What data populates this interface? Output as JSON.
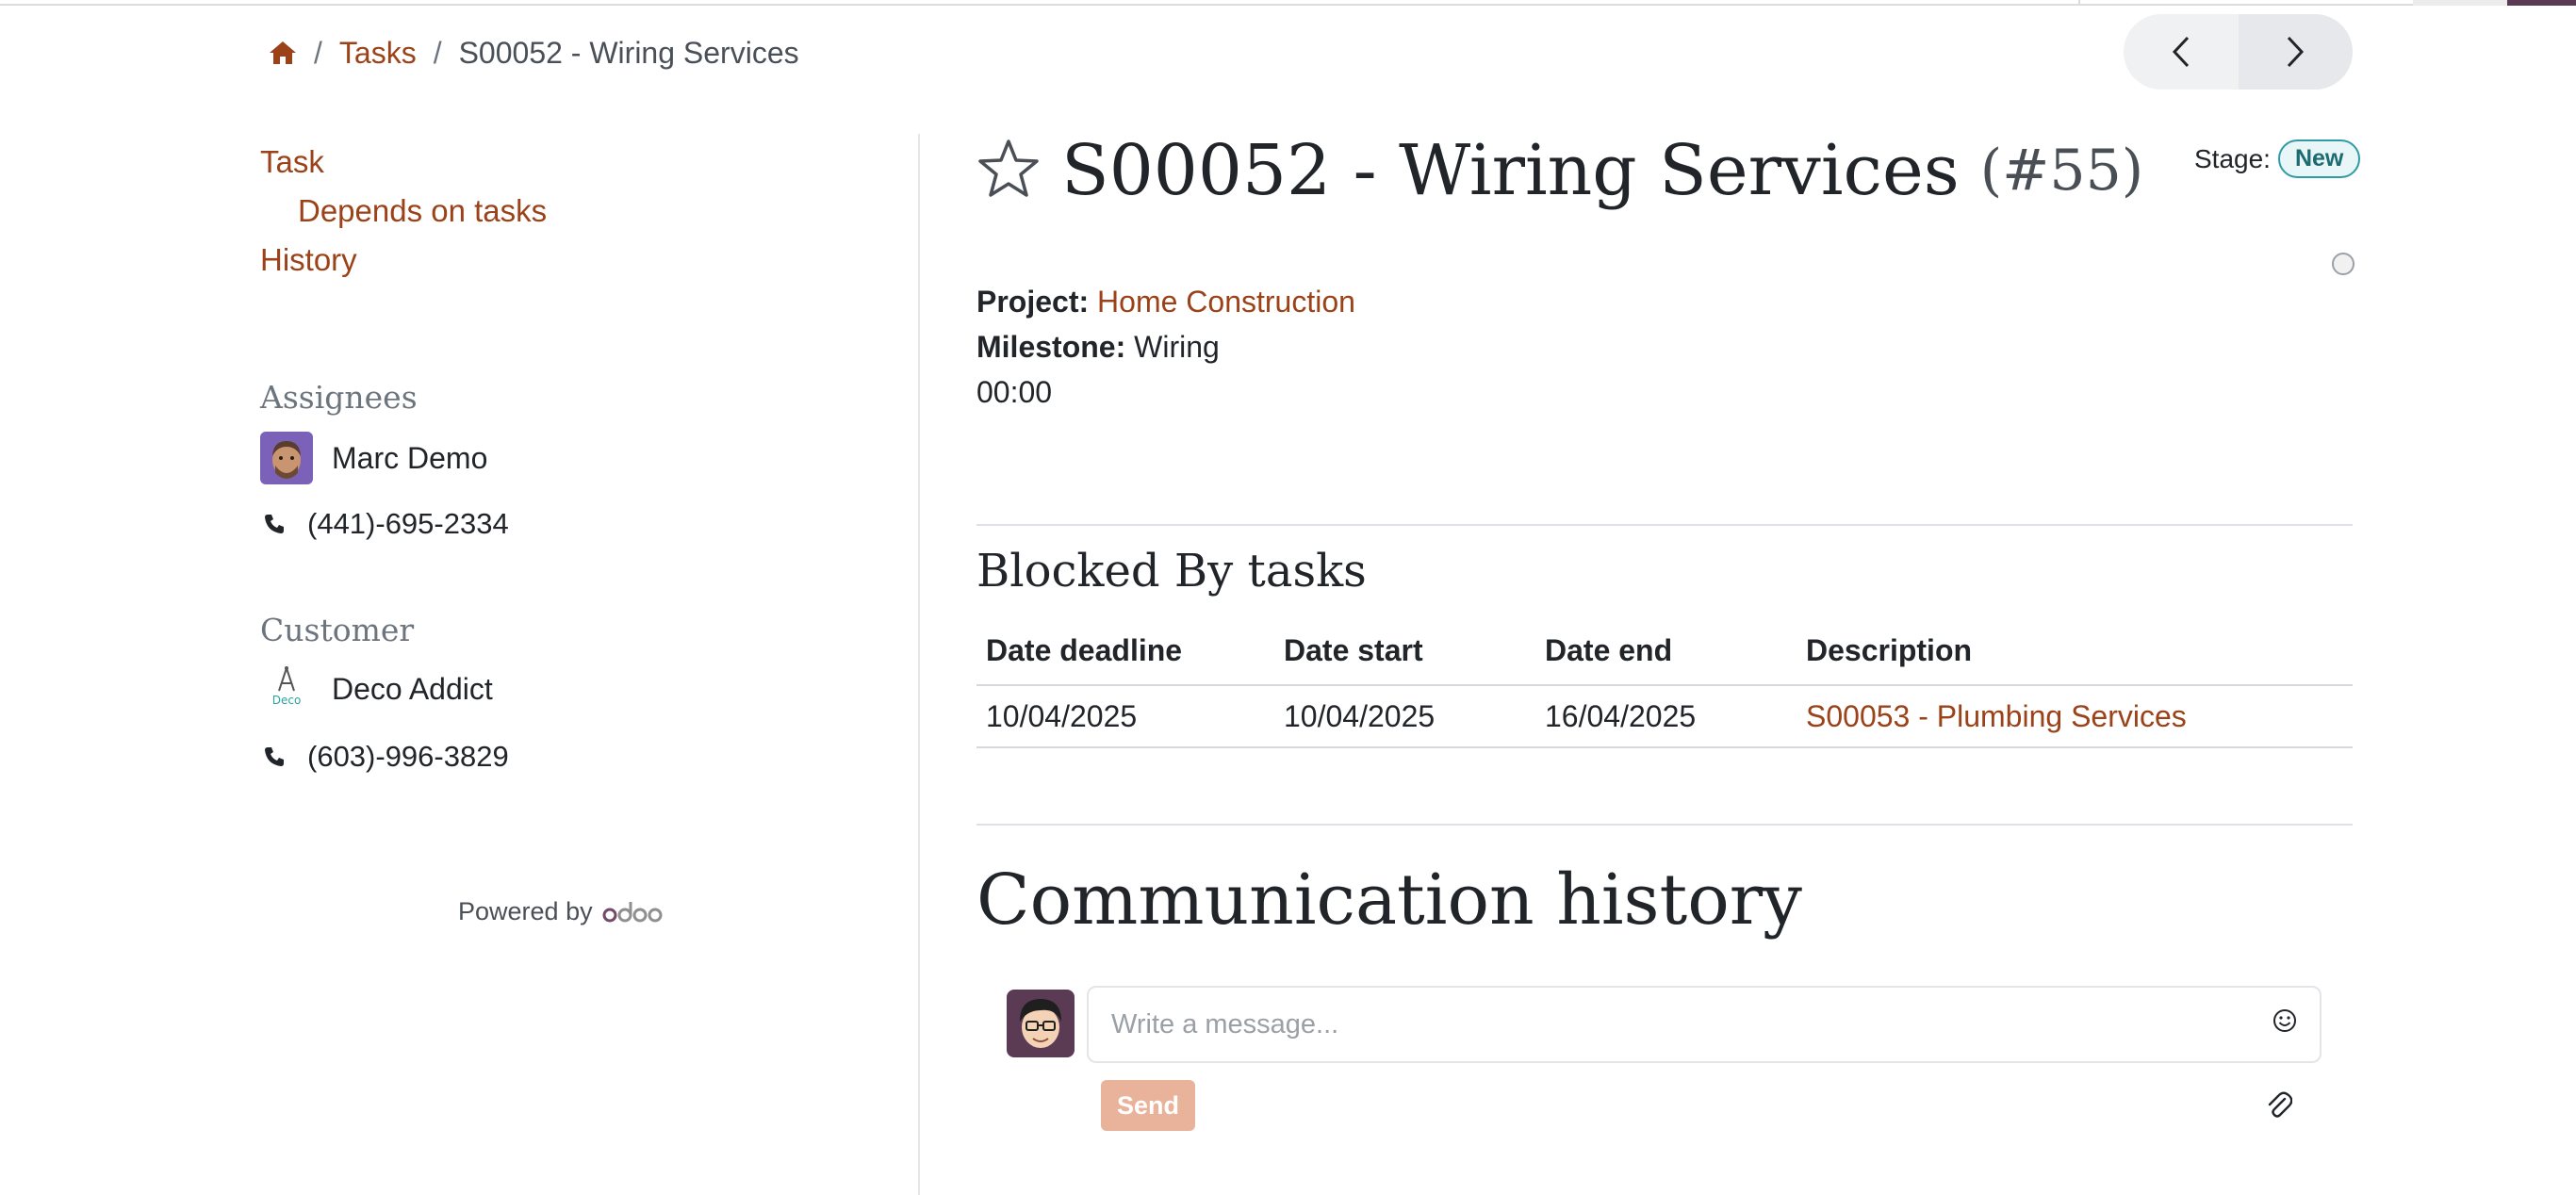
{
  "breadcrumb": {
    "home_icon": "home-icon",
    "tasks": "Tasks",
    "current": "S00052 - Wiring Services"
  },
  "pager": {
    "prev_icon": "chevron-left-icon",
    "next_icon": "chevron-right-icon"
  },
  "toc": {
    "task": "Task",
    "depends": "Depends on tasks",
    "history": "History"
  },
  "assignees": {
    "heading": "Assignees",
    "name": "Marc Demo",
    "phone": "(441)-695-2334"
  },
  "customer": {
    "heading": "Customer",
    "name": "Deco Addict",
    "phone": "(603)-996-3829",
    "logo_text": "Deco"
  },
  "powered": {
    "label": "Powered by",
    "logo": "odoo"
  },
  "task": {
    "title": "S00052 - Wiring Services",
    "number": "(#55)",
    "stage_label": "Stage:",
    "stage_value": "New",
    "project_label": "Project:",
    "project_value": "Home Construction",
    "milestone_label": "Milestone:",
    "milestone_value": "Wiring",
    "time": "00:00"
  },
  "blocked": {
    "title": "Blocked By tasks",
    "columns": [
      "Date deadline",
      "Date start",
      "Date end",
      "Description"
    ],
    "rows": [
      {
        "deadline": "10/04/2025",
        "start": "10/04/2025",
        "end": "16/04/2025",
        "description": "S00053 - Plumbing Services"
      }
    ]
  },
  "communication": {
    "title": "Communication history",
    "placeholder": "Write a message...",
    "send": "Send"
  },
  "colors": {
    "link": "#9b4219",
    "stage_badge": "#2f9ba6",
    "send_button": "#e8b39a"
  }
}
